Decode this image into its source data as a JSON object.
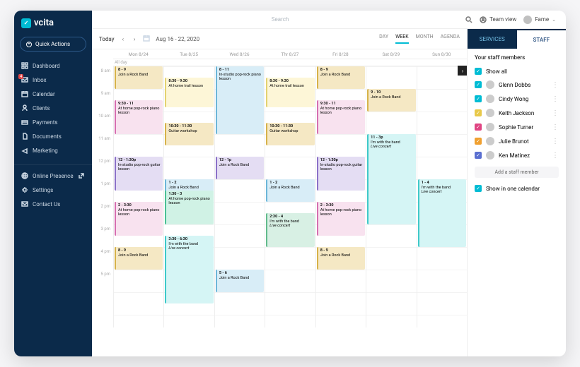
{
  "brand": "vcita",
  "quick_actions": "Quick Actions",
  "nav": {
    "dashboard": "Dashboard",
    "inbox": "Inbox",
    "inbox_badge": "4",
    "calendar": "Calendar",
    "clients": "Clients",
    "payments": "Payments",
    "documents": "Documents",
    "marketing": "Marketing",
    "presence": "Online Presence",
    "settings": "Settings",
    "contact": "Contact Us"
  },
  "top": {
    "search_placeholder": "Search",
    "team_view": "Team view",
    "user_name": "Fame"
  },
  "cal": {
    "today": "Today",
    "range": "Aug 16 - 22, 2020",
    "views": {
      "day": "DAY",
      "week": "WEEK",
      "month": "MONTH",
      "agenda": "AGENDA"
    },
    "days": [
      "Mon 8/24",
      "Tue 8/25",
      "Wed 8/26",
      "Thr 8/27",
      "Fri 8/28",
      "Sat 8/29",
      "Sun 8/30"
    ],
    "all_day": "All day",
    "hours": [
      "8 am",
      "9 am",
      "10 am",
      "11 am",
      "12 pm",
      "1 pm",
      "2 pm",
      "3 pm",
      "4 pm",
      "5 pm"
    ]
  },
  "events": {
    "mon": [
      {
        "t": "8 - 9",
        "d": "Join a Rock Band",
        "c": "c-gold"
      },
      {
        "t": "9:30 - 11",
        "d": "At home pop-rock piano lesson",
        "c": "c-pink"
      },
      {
        "t": "12 - 1:30p",
        "d": "In-studio pop-rock guitar lesson",
        "c": "c-purple"
      },
      {
        "t": "2 - 3:30",
        "d": "At home pop-rock piano lesson",
        "c": "c-pink"
      },
      {
        "t": "8 - 9",
        "d": "Join a Rock Band",
        "c": "c-gold"
      }
    ],
    "tue": [
      {
        "t": "8:30 - 9:30",
        "d": "At home trail lesson",
        "c": "c-yellow"
      },
      {
        "t": "10:30 - 11:30",
        "d": "Guitar workshop",
        "c": "c-gold"
      },
      {
        "t": "1 - 2",
        "d": "Join a Rock Band",
        "c": "c-blue"
      },
      {
        "t": "1:30 - 3",
        "d": "At home pop-rock piano lesson",
        "c": "c-teal"
      },
      {
        "t": "3:30 - 6:30",
        "d": "I'm with the band",
        "i": "Live concert",
        "c": "c-cyan"
      }
    ],
    "wed": [
      {
        "t": "8 - 11",
        "d": "In-studio pop-rock piano lesson",
        "c": "c-blue"
      },
      {
        "t": "12 - 1p",
        "d": "Join a Rock Band",
        "c": "c-purple"
      },
      {
        "t": "5 - 6",
        "d": "Join a Rock Band",
        "c": "c-blue"
      }
    ],
    "thr": [
      {
        "t": "8:30 - 9:30",
        "d": "At home trail lesson",
        "c": "c-yellow"
      },
      {
        "t": "10:30 - 11:30",
        "d": "Guitar workshop",
        "c": "c-gold"
      },
      {
        "t": "1 - 2",
        "d": "Join a Rock Band",
        "c": "c-blue"
      },
      {
        "t": "2:30 - 4",
        "d": "I'm with the band",
        "i": "Live concert",
        "c": "c-mint"
      }
    ],
    "fri": [
      {
        "t": "8 - 9",
        "d": "Join a Rock Band",
        "c": "c-gold"
      },
      {
        "t": "9:30 - 11",
        "d": "At home pop-rock piano lesson",
        "c": "c-pink"
      },
      {
        "t": "12 - 1:30p",
        "d": "In-studio pop-rock guitar lesson",
        "c": "c-purple"
      },
      {
        "t": "2 - 3:30",
        "d": "At home pop-rock piano lesson",
        "c": "c-pink"
      },
      {
        "t": "8 - 9",
        "d": "Join a Rock Band",
        "c": "c-gold"
      }
    ],
    "sat": [
      {
        "t": "9 - 10",
        "d": "Join a Rock Band",
        "c": "c-gold"
      },
      {
        "t": "11 - 3p",
        "d": "I'm with the band",
        "i": "Live concert",
        "c": "c-cyan"
      }
    ],
    "sun": [
      {
        "t": "1 - 4",
        "d": "I'm with the band",
        "i": "Live concert",
        "c": "c-cyan"
      }
    ]
  },
  "rpanel": {
    "tab_services": "SERVICES",
    "tab_staff": "STAFF",
    "title": "Your staff  members",
    "show_all": "Show all",
    "add": "Add a staff member",
    "show_one": "Show in one calendar",
    "staff": [
      {
        "name": "Glenn Dobbs",
        "color": "#00bcd4"
      },
      {
        "name": "Cindy Wong",
        "color": "#00bcd4"
      },
      {
        "name": "Keith Jackson",
        "color": "#e8c94a"
      },
      {
        "name": "Sophie Turner",
        "color": "#e04583"
      },
      {
        "name": "Julie Brunot",
        "color": "#f0a030"
      },
      {
        "name": "Ken Matinez",
        "color": "#5a6fd0"
      }
    ]
  }
}
